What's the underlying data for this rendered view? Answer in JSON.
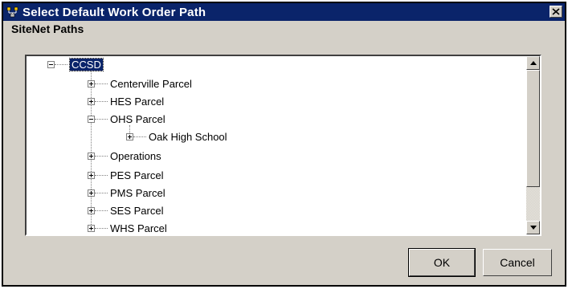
{
  "window": {
    "title": "Select Default Work Order Path",
    "close_glyph": "✕"
  },
  "section_label": "SiteNet Paths",
  "tree": {
    "root": {
      "label": "CCSD",
      "expanded": true,
      "selected": true
    },
    "children": [
      {
        "label": "Centerville Parcel",
        "expanded": false
      },
      {
        "label": "HES Parcel",
        "expanded": false
      },
      {
        "label": "OHS Parcel",
        "expanded": true,
        "children": [
          {
            "label": "Oak High School",
            "expanded": false
          }
        ]
      },
      {
        "label": "Operations",
        "expanded": false
      },
      {
        "label": "PES Parcel",
        "expanded": false
      },
      {
        "label": "PMS Parcel",
        "expanded": false
      },
      {
        "label": "SES Parcel",
        "expanded": false
      },
      {
        "label": "WHS Parcel",
        "expanded": false
      }
    ]
  },
  "buttons": {
    "ok": "OK",
    "cancel": "Cancel"
  },
  "colors": {
    "titlebar": "#0a246a",
    "selection": "#0a246a",
    "face": "#d4d0c8"
  },
  "icons": {
    "app": "network-tree-icon",
    "close": "close-icon",
    "scroll_up": "arrow-up-icon",
    "scroll_down": "arrow-down-icon"
  }
}
